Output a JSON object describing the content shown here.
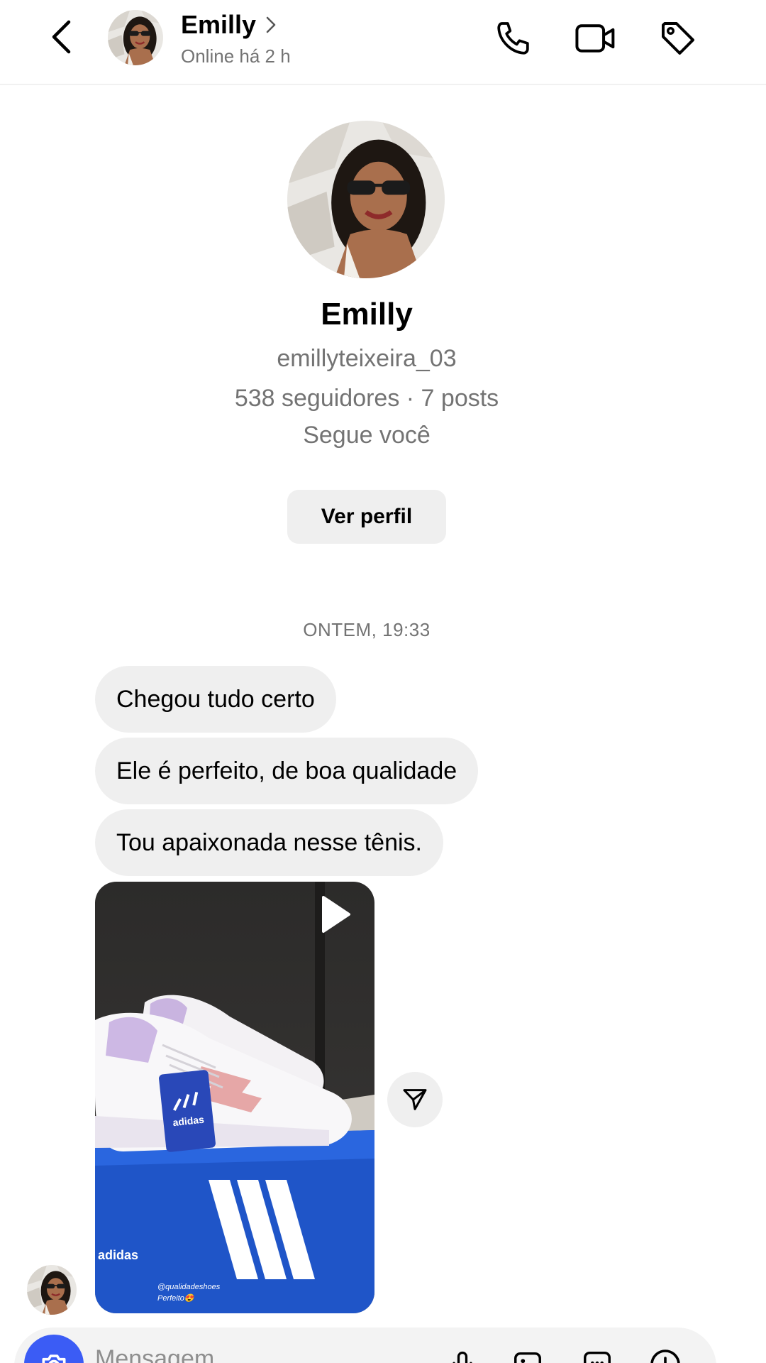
{
  "header": {
    "name": "Emilly",
    "status": "Online há 2 h"
  },
  "profile": {
    "name": "Emilly",
    "username": "emillyteixeira_03",
    "stats": "538 seguidores · 7 posts",
    "follows_you": "Segue você",
    "view_profile_label": "Ver perfil"
  },
  "thread": {
    "timestamp": "ONTEM, 19:33",
    "messages": [
      "Chegou tudo certo",
      "Ele é perfeito, de boa qualidade",
      "Tou apaixonada nesse tênis."
    ],
    "media": {
      "box_brand": "adidas",
      "tag_brand": "adidas",
      "caption_handle": "@qualidadeshoes",
      "caption_text": "Perfeito😍"
    }
  },
  "composer": {
    "placeholder": "Mensagem"
  },
  "icons": {
    "back": "chevron-left-icon",
    "header_chevron": "chevron-right-icon",
    "call": "phone-icon",
    "video": "video-camera-icon",
    "tag": "tag-icon",
    "share": "send-icon",
    "play": "play-icon",
    "camera": "camera-icon",
    "mic": "microphone-icon",
    "gallery": "image-icon",
    "sticker": "sticker-icon",
    "more": "plus-circle-icon"
  },
  "colors": {
    "bubble_bg": "#efefef",
    "secondary_text": "#737373",
    "camera_button": "#3b5cf5",
    "adidas_blue": "#1f55c8"
  }
}
